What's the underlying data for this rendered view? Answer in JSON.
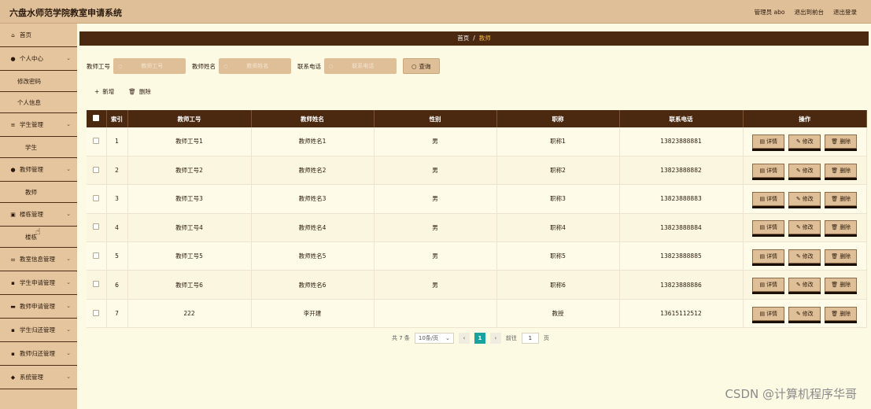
{
  "app": {
    "title": "六盘水师范学院教室申请系统"
  },
  "header": {
    "user": "管理员 abo",
    "front_link": "退出到前台",
    "logout": "退出登录"
  },
  "sidebar": {
    "items": [
      {
        "label": "首页",
        "icon": "home-icon"
      },
      {
        "label": "个人中心",
        "icon": "user-icon"
      },
      {
        "label": "修改密码"
      },
      {
        "label": "个人信息"
      },
      {
        "label": "学生管理",
        "icon": "list-icon"
      },
      {
        "label": "学生"
      },
      {
        "label": "教师管理",
        "icon": "user-icon"
      },
      {
        "label": "教师"
      },
      {
        "label": "楼栋管理",
        "icon": "building-icon"
      },
      {
        "label": "楼栋"
      },
      {
        "label": "教室信息管理",
        "icon": "room-icon"
      },
      {
        "label": "学生申请管理",
        "icon": "grid-icon"
      },
      {
        "label": "教师申请管理",
        "icon": "doc-icon"
      },
      {
        "label": "学生归还管理",
        "icon": "grid-icon"
      },
      {
        "label": "教师归还管理",
        "icon": "grid-icon"
      },
      {
        "label": "系统管理",
        "icon": "shield-icon"
      }
    ]
  },
  "breadcrumb": {
    "home": "首页",
    "separator": "/",
    "current": "教师"
  },
  "search": {
    "teacher_no_label": "教师工号",
    "teacher_no_placeholder": "教师工号",
    "teacher_name_label": "教师姓名",
    "teacher_name_placeholder": "教师姓名",
    "phone_label": "联系电话",
    "phone_placeholder": "联系电话",
    "query_button": "查询"
  },
  "toolbar": {
    "add": "新增",
    "delete": "删除"
  },
  "table": {
    "headers": [
      "索引",
      "教师工号",
      "教师姓名",
      "性别",
      "职称",
      "联系电话",
      "操作"
    ],
    "rows": [
      {
        "index": "1",
        "no": "教师工号1",
        "name": "教师姓名1",
        "gender": "男",
        "title": "职称1",
        "phone": "13823888881"
      },
      {
        "index": "2",
        "no": "教师工号2",
        "name": "教师姓名2",
        "gender": "男",
        "title": "职称2",
        "phone": "13823888882"
      },
      {
        "index": "3",
        "no": "教师工号3",
        "name": "教师姓名3",
        "gender": "男",
        "title": "职称3",
        "phone": "13823888883"
      },
      {
        "index": "4",
        "no": "教师工号4",
        "name": "教师姓名4",
        "gender": "男",
        "title": "职称4",
        "phone": "13823888884"
      },
      {
        "index": "5",
        "no": "教师工号5",
        "name": "教师姓名5",
        "gender": "男",
        "title": "职称5",
        "phone": "13823888885"
      },
      {
        "index": "6",
        "no": "教师工号6",
        "name": "教师姓名6",
        "gender": "男",
        "title": "职称6",
        "phone": "13823888886"
      },
      {
        "index": "7",
        "no": "222",
        "name": "李开建",
        "gender": "",
        "title": "教授",
        "phone": "13615112512"
      }
    ],
    "ops": {
      "detail": "详情",
      "edit": "修改",
      "delete": "删除"
    }
  },
  "pager": {
    "total": "共 7 条",
    "page_size": "10条/页",
    "current_page": "1",
    "goto_label": "前往",
    "goto_value": "1",
    "page_unit": "页"
  },
  "watermark": "CSDN @计算机程序华哥"
}
